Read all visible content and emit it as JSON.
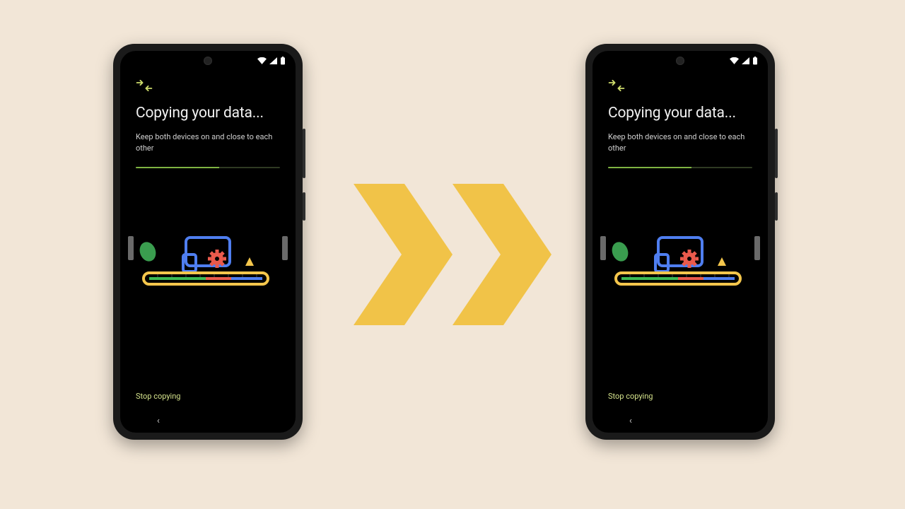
{
  "colors": {
    "background": "#f2e6d7",
    "accent_arrow": "#f1c348",
    "accent_green": "#7fb342",
    "accent_lime": "#d5e38c",
    "google_blue": "#4f7ef0",
    "google_red": "#ea5a4c",
    "google_yellow": "#f4c64c",
    "google_green": "#3cba54"
  },
  "decor": {
    "icons": [
      "transfer-arrows-icon",
      "status-wifi-icon",
      "status-signal-icon",
      "status-battery-icon",
      "back-icon"
    ],
    "blob_color": "#3a9d4f"
  },
  "phones": [
    {
      "key": "left",
      "title": "Copying your data...",
      "subtitle": "Keep both devices on and close to each other",
      "progress_pct": 58,
      "stop_label": "Stop copying",
      "nav_back": "‹"
    },
    {
      "key": "right",
      "title": "Copying your data...",
      "subtitle": "Keep both devices on and close to each other",
      "progress_pct": 58,
      "stop_label": "Stop copying",
      "nav_back": "‹"
    }
  ]
}
